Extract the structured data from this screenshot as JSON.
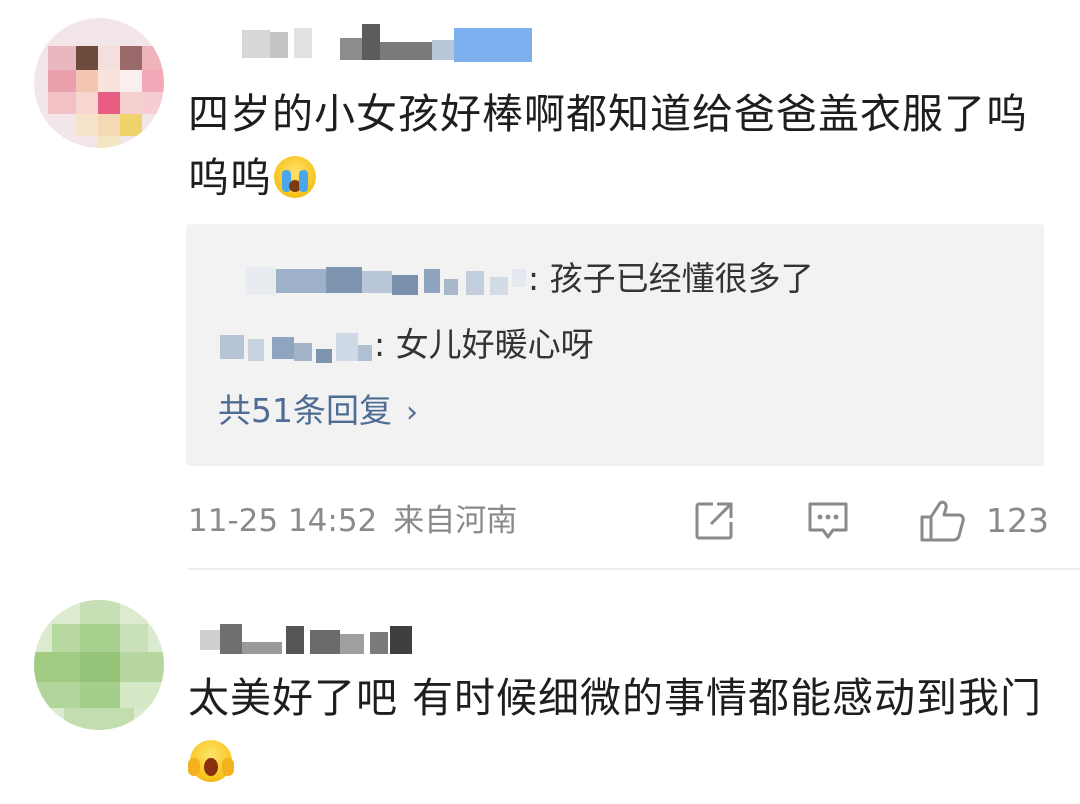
{
  "comments": [
    {
      "text": "四岁的小女孩好棒啊都知道给爸爸盖衣服了呜呜呜",
      "emoji": "loudly-crying-face-emoji",
      "replies": [
        {
          "text": ": 孩子已经懂很多了"
        },
        {
          "text": ": 女儿好暖心呀"
        }
      ],
      "more_replies": "共51条回复",
      "meta": {
        "time": "11-25 14:52",
        "source": "来自河南",
        "like_count": "123"
      }
    },
    {
      "text": "太美好了吧 有时候细微的事情都能感动到我门",
      "emoji": "face-screaming-in-fear-emoji"
    }
  ],
  "icons": {
    "share": "share-icon",
    "comment": "comment-icon",
    "like": "thumbs-up-icon",
    "chevron": "chevron-right-icon"
  },
  "colors": {
    "link": "#4f6d94",
    "meta": "#8a8a8a",
    "reply_bg": "#f2f2f2",
    "divider": "#ececec"
  }
}
